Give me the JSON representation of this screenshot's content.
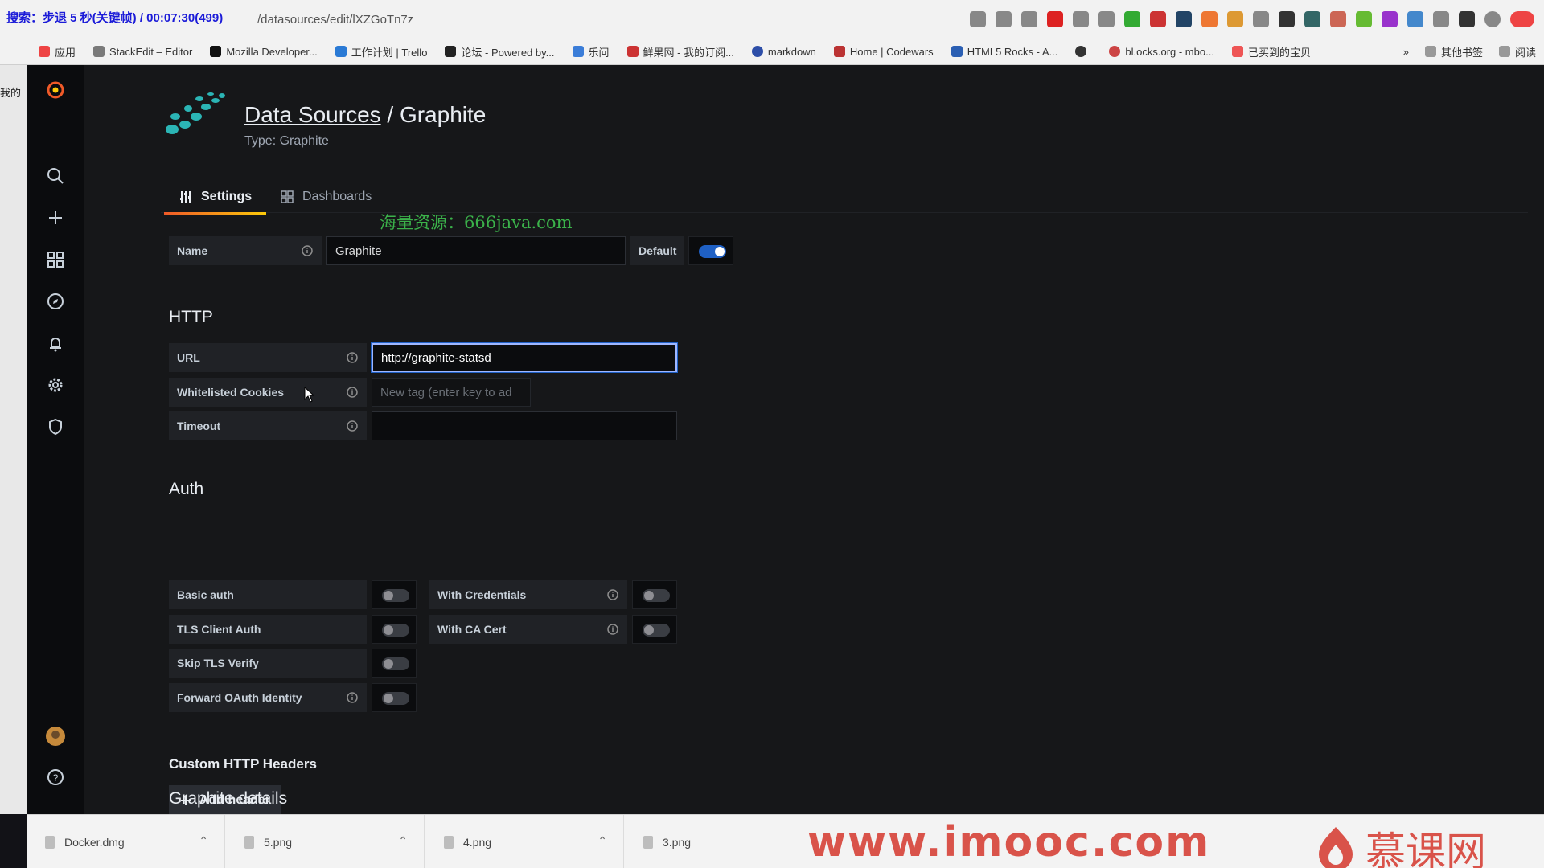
{
  "browser": {
    "overlay_text": "搜索：步退 5 秒(关键帧) / 00:07:30(499)",
    "url": "/datasources/edit/lXZGoTn7z",
    "bookmarks": [
      {
        "label": "应用"
      },
      {
        "label": "StackEdit – Editor"
      },
      {
        "label": "Mozilla Developer..."
      },
      {
        "label": "工作计划 | Trello"
      },
      {
        "label": "论坛 - Powered by..."
      },
      {
        "label": "乐问"
      },
      {
        "label": "鲜果网 - 我的订阅..."
      },
      {
        "label": "markdown"
      },
      {
        "label": "Home | Codewars"
      },
      {
        "label": "HTML5 Rocks - A..."
      },
      {
        "label": ""
      },
      {
        "label": "bl.ocks.org - mbo..."
      },
      {
        "label": "已买到的宝贝"
      }
    ],
    "bookmarks_more": "»",
    "other_bookmarks": "其他书签",
    "reading_list": "阅读",
    "left_window_label": "我的"
  },
  "sidemenu": {
    "items": [
      "grafana-logo",
      "search-icon",
      "plus-icon",
      "dashboards-icon",
      "explore-icon",
      "alerting-icon",
      "configuration-icon",
      "shield-icon",
      "avatar",
      "help-icon"
    ]
  },
  "header": {
    "title_link": "Data Sources",
    "title_sep": " / ",
    "title_name": "Graphite",
    "subtitle": "Type: Graphite"
  },
  "tabs": [
    {
      "label": "Settings",
      "active": true
    },
    {
      "label": "Dashboards",
      "active": false
    }
  ],
  "watermark": "海量资源：666java.com",
  "name_row": {
    "label": "Name",
    "value": "Graphite",
    "default_label": "Default",
    "default_on": true
  },
  "http": {
    "title": "HTTP",
    "url_label": "URL",
    "url_value": "http://graphite-statsd",
    "cookies_label": "Whitelisted Cookies",
    "cookies_placeholder": "New tag (enter key to ad",
    "timeout_label": "Timeout",
    "timeout_value": ""
  },
  "auth": {
    "title": "Auth",
    "basic_auth": "Basic auth",
    "with_credentials": "With Credentials",
    "tls_client_auth": "TLS Client Auth",
    "with_ca_cert": "With CA Cert",
    "skip_tls_verify": "Skip TLS Verify",
    "forward_oauth": "Forward OAuth Identity"
  },
  "custom_headers": {
    "title": "Custom HTTP Headers",
    "add_button": "Add header"
  },
  "graphite_details": {
    "title": "Graphite details"
  },
  "downloads": [
    {
      "name": "Docker.dmg"
    },
    {
      "name": "5.png"
    },
    {
      "name": "4.png"
    },
    {
      "name": "3.png"
    }
  ],
  "branding": {
    "site": "www.imooc.com",
    "cn": "慕课网"
  },
  "colors": {
    "accent_blue": "#1f60c4",
    "tab_gradient_start": "#f05a28",
    "tab_gradient_end": "#fbca0a",
    "brand_red": "#d9534a"
  }
}
